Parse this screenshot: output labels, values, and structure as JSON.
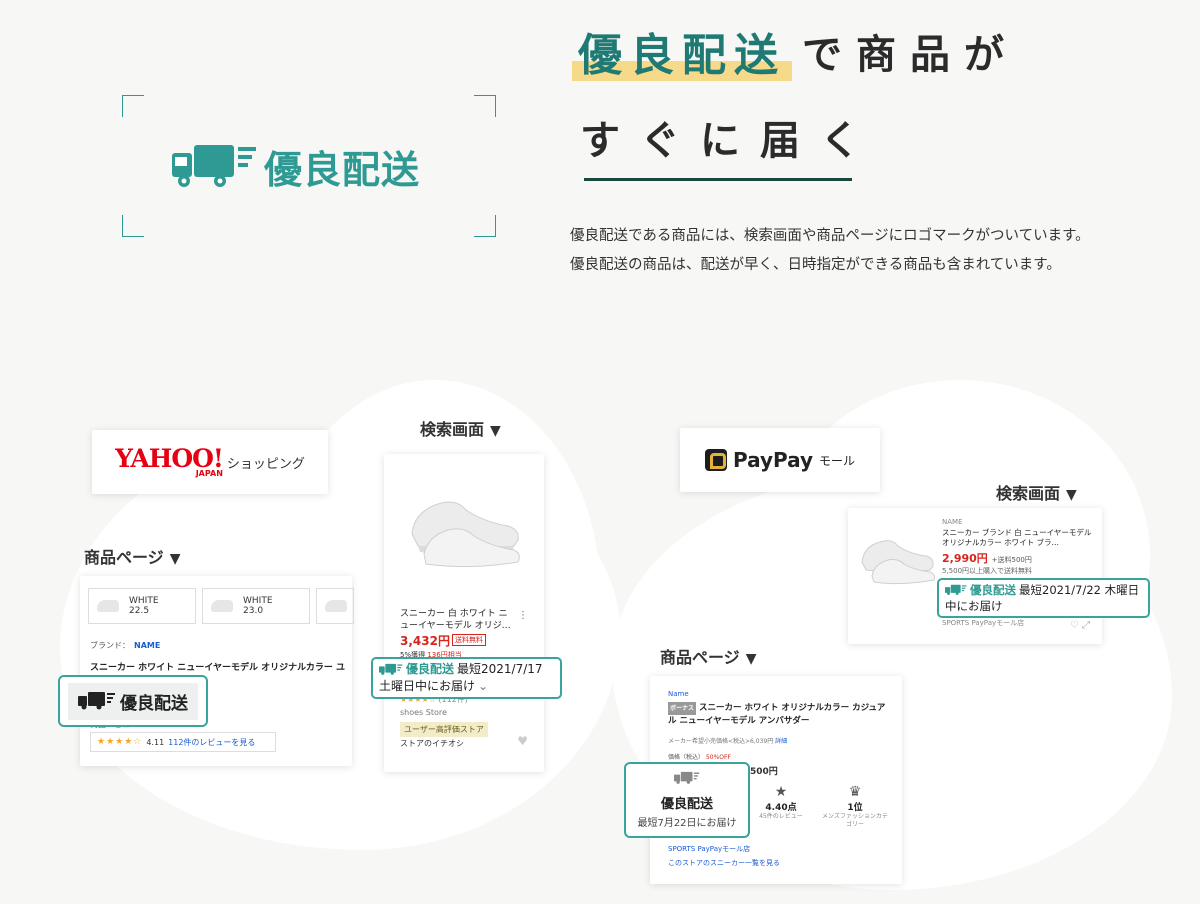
{
  "hero": {
    "logo_text": "優良配送",
    "headline_highlight": "優良配送",
    "headline_rest": "で商品が",
    "headline_line2": "すぐに届く",
    "description": "優良配送である商品には、検索画面や商品ページにロゴマークがついています。優良配送の商品は、配送が早く、日時指定ができる商品も含まれています。"
  },
  "yahoo": {
    "logo_word": "YAHOO!",
    "logo_sub": "JAPAN",
    "logo_shop": "ショッピング",
    "product_page_label": "商品ページ",
    "search_label": "検索画面",
    "product_card": {
      "variants": [
        {
          "color": "WHITE",
          "size": "22.5"
        },
        {
          "color": "WHITE",
          "size": "23.0"
        }
      ],
      "brand_label": "ブランド：",
      "brand_name": "NAME",
      "title": "スニーカー ホワイト ニューイヤーモデル オリジナルカラー ユ",
      "review_label": "商品レビュー",
      "stars": "★★★★☆",
      "rating": "4.11",
      "review_link": "112件のレビューを見る"
    },
    "badge_text": "優良配送",
    "search_card": {
      "title": "スニーカー 白 ホワイト ニューイヤーモデル オリジ…",
      "price": "3,432円",
      "free_shipping": "送料無料",
      "points_label": "5%獲得",
      "points_value": "136円相当",
      "review_count": "(112件)",
      "stars": "★★★★☆",
      "store": "shoes Store",
      "tag": "ユーザー高評価ストア",
      "ichioshi": "ストアのイチオシ"
    },
    "search_badge": {
      "label": "優良配送",
      "date": "最短2021/7/17",
      "day": "土曜日中にお届け"
    }
  },
  "paypay": {
    "logo_word": "PayPay",
    "logo_mall": "モール",
    "search_label": "検索画面",
    "product_page_label": "商品ページ",
    "search_card": {
      "name": "NAME",
      "title": "スニーカー ブランド 白 ニューイヤーモデル オリジナルカラー ホワイト ブラ…",
      "price": "2,990円",
      "price_note": "+送料500円",
      "ship_note": "5,500円以上購入で送料無料",
      "store": "SPORTS PayPayモール店"
    },
    "search_badge": {
      "label": "優良配送",
      "date": "最短2021/7/22 木曜日",
      "day": "中にお届け"
    },
    "product_card": {
      "name": "Name",
      "badge": "ボーナス",
      "title": "スニーカー ホワイト オリジナルカラー カジュアル ニューイヤーモデル アンバサダー",
      "maker_note": "メーカー希望小売価格<税込>6,039円",
      "maker_link": "詳細",
      "price_label": "価格（税込）",
      "discount": "50%OFF",
      "price": "500円",
      "rating": "4.40点",
      "rating_label": "45件のレビュー",
      "rank": "1位",
      "rank_label": "メンズファッションカテゴリー",
      "store": "SPORTS PayPayモール店",
      "link": "このストアのスニーカー一覧を見る"
    },
    "product_badge": {
      "label": "優良配送",
      "date": "最短7月22日にお届け"
    }
  }
}
